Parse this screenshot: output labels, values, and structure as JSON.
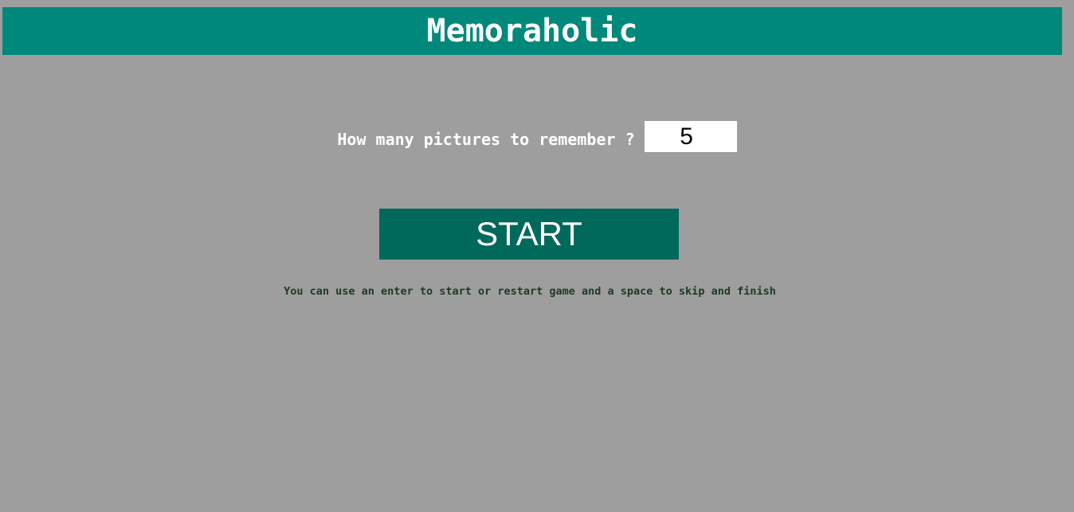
{
  "header": {
    "title": "Memoraholic"
  },
  "settings": {
    "question_label": "How many pictures to remember ?",
    "pictures_count": "5"
  },
  "controls": {
    "start_label": "START"
  },
  "hint": {
    "text": "You can use an enter to start or restart game and a space to skip and finish"
  },
  "colors": {
    "background": "#9e9e9e",
    "header": "#00897b",
    "start_button": "#00695c",
    "hint_text": "#1e3a24"
  }
}
